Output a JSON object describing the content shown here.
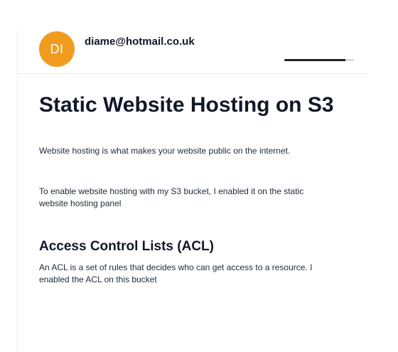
{
  "user": {
    "avatar_initials": "DI",
    "avatar_color": "#f29c1f",
    "email": "diame@hotmail.co.uk"
  },
  "progress": {
    "percent": 88
  },
  "article": {
    "title": "Static Website Hosting on S3",
    "paragraph1": "Website hosting is what makes your website public on the internet.",
    "paragraph2": "To enable website hosting with my S3 bucket, I enabled it on the static website hosting panel",
    "section_heading": "Access Control Lists (ACL)",
    "paragraph3": "An ACL is a set of rules that decides who can get access to a resource. I enabled the ACL on this bucket"
  }
}
